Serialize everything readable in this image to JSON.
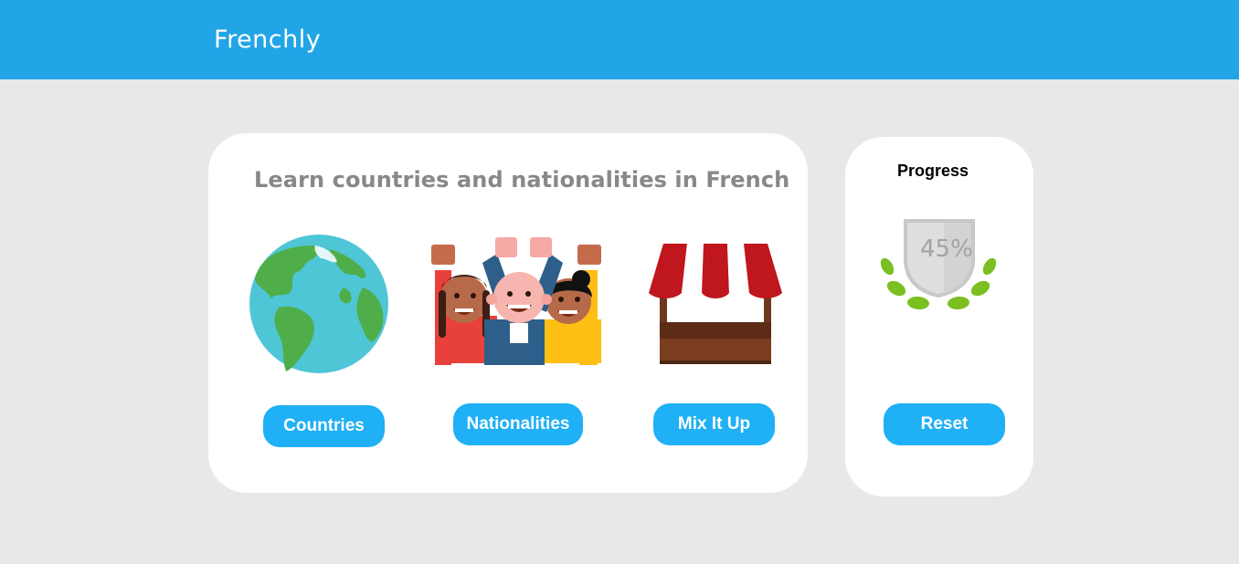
{
  "app": {
    "brand": "Frenchly",
    "accent_color": "#21a5e6",
    "button_color": "#1fb0f5"
  },
  "main": {
    "title": "Learn countries and nationalities in French",
    "options": [
      {
        "label": "Countries",
        "icon": "globe-icon"
      },
      {
        "label": "Nationalities",
        "icon": "people-icon"
      },
      {
        "label": "Mix It Up",
        "icon": "market-stall-icon"
      }
    ]
  },
  "progress": {
    "title": "Progress",
    "percent_label": "45%",
    "percent": 45,
    "icon": "shield-laurel-icon",
    "reset_label": "Reset"
  }
}
